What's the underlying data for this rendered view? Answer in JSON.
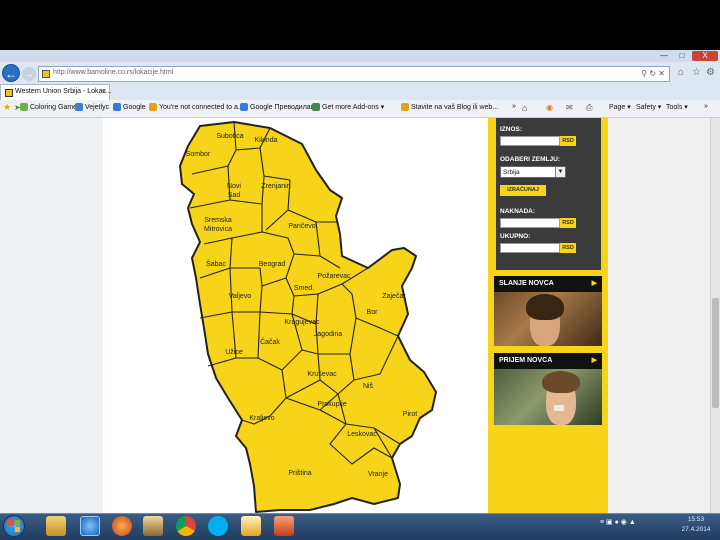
{
  "browser": {
    "window_controls": {
      "minimize": "—",
      "maximize": "□",
      "close": "X"
    },
    "url": "http://www.bamoline.co.rs/lokacije.html",
    "tab": {
      "label": "Western Union Srbija - Lokac...",
      "close": "×"
    },
    "favorites": [
      {
        "label": "Coloring Games",
        "color": "#6bb04a"
      },
      {
        "label": "Vejetlyc",
        "color": "#3a7bd5"
      },
      {
        "label": "Google",
        "color": "#3a7bd5"
      },
      {
        "label": "You're not connected to a...",
        "color": "#e3a21a"
      },
      {
        "label": "Google Преводилац",
        "color": "#3a7bd5"
      },
      {
        "label": "Get more Add-ons ▾",
        "color": "#3d8c40"
      },
      {
        "label": "Stavite na vaš Blog ili web...",
        "color": "#e3a21a"
      }
    ],
    "commandbar": [
      "»",
      "Page ▾",
      "Safety ▾",
      "Tools ▾",
      "»"
    ]
  },
  "map": {
    "fill": "#f7d31a",
    "stroke": "#222222",
    "regions": [
      {
        "name": "Subotica"
      },
      {
        "name": "Kikinda"
      },
      {
        "name": "Sombor"
      },
      {
        "name": "Novi Sad"
      },
      {
        "name": "Zrenjanin"
      },
      {
        "name": "Sremska Mitrovica"
      },
      {
        "name": "Pančevo"
      },
      {
        "name": "Šabac"
      },
      {
        "name": "Beograd"
      },
      {
        "name": "Požarevac"
      },
      {
        "name": "Smed."
      },
      {
        "name": "Zaječar"
      },
      {
        "name": "Valjevo"
      },
      {
        "name": "Bor"
      },
      {
        "name": "Kragujevac"
      },
      {
        "name": "Jagodina"
      },
      {
        "name": "Čačak"
      },
      {
        "name": "Užice"
      },
      {
        "name": "Kruševac"
      },
      {
        "name": "Niš"
      },
      {
        "name": "Kraljevo"
      },
      {
        "name": "Prokuplje"
      },
      {
        "name": "Pirot"
      },
      {
        "name": "Leskovac"
      },
      {
        "name": "Priština"
      },
      {
        "name": "Vranje"
      }
    ]
  },
  "converter": {
    "amount_label": "IZNOS:",
    "unit": "RSD",
    "country_label": "ODABERI ZEMLJU:",
    "country_value": "Srbija",
    "select_arrow": "▼",
    "calc_button": "IZRAČUNAJ",
    "fee_label": "NAKNADA:",
    "total_label": "UKUPNO:"
  },
  "promos": [
    {
      "title": "SLANJE NOVCA",
      "arrow": "▶"
    },
    {
      "title": "PRIJEM NOVCA",
      "arrow": "▶"
    }
  ],
  "taskbar": {
    "time": "15:53",
    "date": "27.4.2014"
  }
}
